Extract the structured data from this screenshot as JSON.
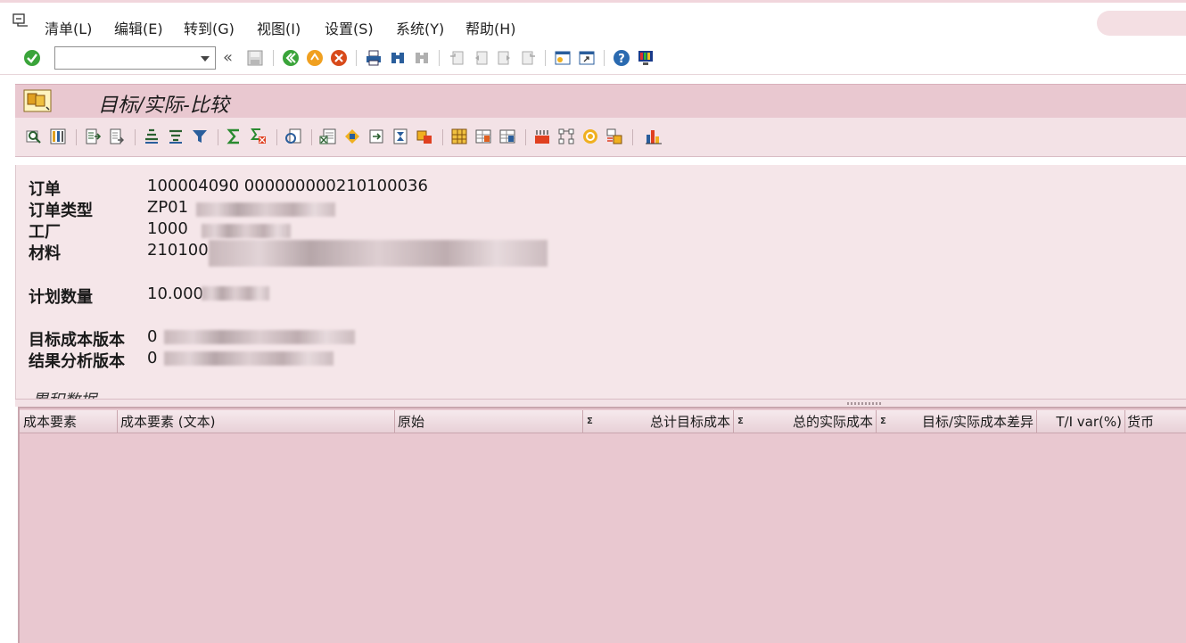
{
  "menu": {
    "items": [
      "清单(L)",
      "编辑(E)",
      "转到(G)",
      "视图(I)",
      "设置(S)",
      "系统(Y)",
      "帮助(H)"
    ]
  },
  "toolbar": {
    "command_value": "",
    "back_label": "«"
  },
  "title": "目标/实际-比较",
  "header": {
    "order_label": "订单",
    "order_value": "100004090 000000000210100036",
    "order_type_label": "订单类型",
    "order_type_value": "ZP01",
    "plant_label": "工厂",
    "plant_value": "1000",
    "material_label": "材料",
    "material_value": "210100",
    "planned_qty_label": "计划数量",
    "planned_qty_value": "10.000",
    "target_version_label": "目标成本版本",
    "target_version_value": "0",
    "result_version_label": "结果分析版本",
    "result_version_value": "0",
    "cumulative_label": "累积数据"
  },
  "grid": {
    "sigma": "Σ",
    "columns": [
      "成本要素",
      "成本要素 (文本)",
      "原始",
      "总计目标成本",
      "总的实际成本",
      "目标/实际成本差异",
      "T/I var(%)",
      "货币"
    ]
  },
  "colors": {
    "title_bg": "#e9c8d0",
    "grid_bg": "#e9c8d0",
    "header_bg": "#f5e6e9"
  }
}
